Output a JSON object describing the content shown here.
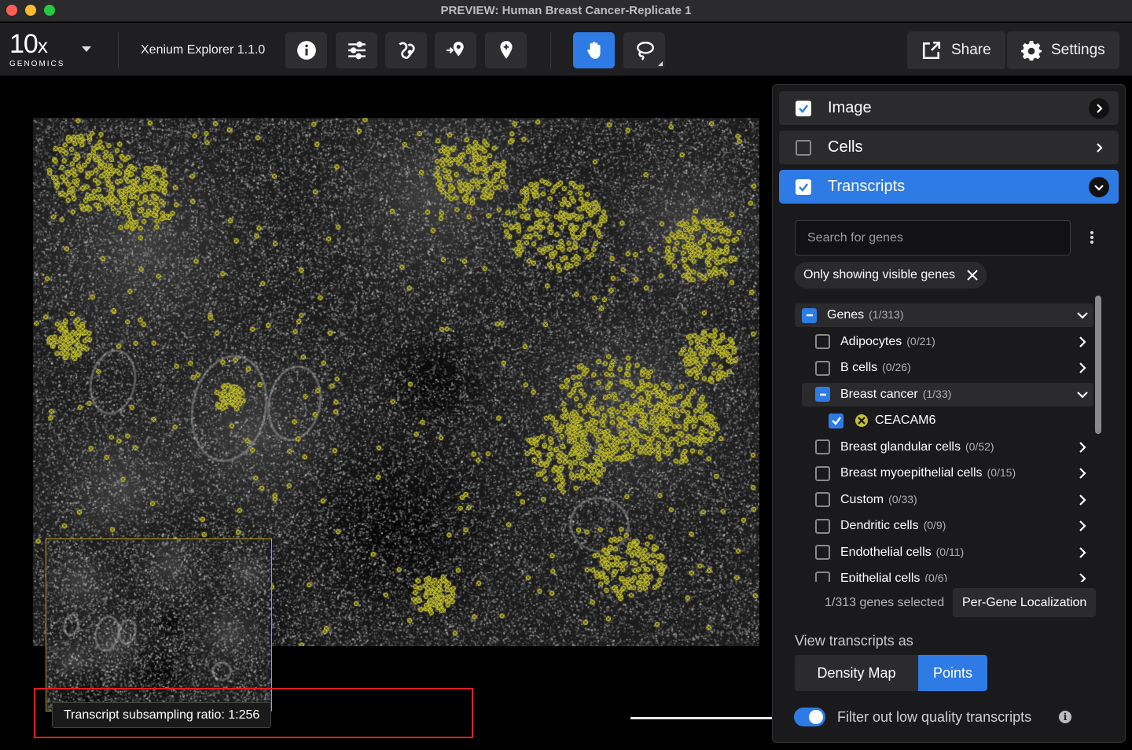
{
  "window": {
    "title": "PREVIEW: Human Breast Cancer-Replicate 1"
  },
  "toolbar": {
    "logo_main": "10",
    "logo_x": "x",
    "logo_sub": "GENOMICS",
    "app_name": "Xenium Explorer 1.1.0",
    "tools": [
      {
        "name": "info-icon",
        "active": false
      },
      {
        "name": "sliders-icon",
        "active": false
      },
      {
        "name": "cell-segment-icon",
        "active": false
      },
      {
        "name": "go-to-location-icon",
        "active": false
      },
      {
        "name": "pin-icon",
        "active": false
      },
      {
        "name": "hand-pan-icon",
        "active": true
      },
      {
        "name": "lasso-icon",
        "active": false
      }
    ],
    "share_label": "Share",
    "settings_label": "Settings"
  },
  "viewer": {
    "status_text": "Transcript subsampling ratio: 1:256",
    "transcript_color": "#c5c12b"
  },
  "panel": {
    "sections": [
      {
        "label": "Image",
        "checked": true,
        "expanded": false
      },
      {
        "label": "Cells",
        "checked": false,
        "expanded": false
      },
      {
        "label": "Transcripts",
        "checked": true,
        "expanded": true
      }
    ],
    "search_placeholder": "Search for genes",
    "filter_chip": "Only showing visible genes",
    "genes": [
      {
        "label": "Genes",
        "count": "(1/313)",
        "state": "partial",
        "level": 0,
        "expanded": true
      },
      {
        "label": "Adipocytes",
        "count": "(0/21)",
        "state": "off",
        "level": 1
      },
      {
        "label": "B cells",
        "count": "(0/26)",
        "state": "off",
        "level": 1
      },
      {
        "label": "Breast cancer",
        "count": "(1/33)",
        "state": "partial",
        "level": 1,
        "expanded": true
      },
      {
        "label": "CEACAM6",
        "count": "",
        "state": "on",
        "level": 2
      },
      {
        "label": "Breast glandular cells",
        "count": "(0/52)",
        "state": "off",
        "level": 1
      },
      {
        "label": "Breast myoepithelial cells",
        "count": "(0/15)",
        "state": "off",
        "level": 1
      },
      {
        "label": "Custom",
        "count": "(0/33)",
        "state": "off",
        "level": 1
      },
      {
        "label": "Dendritic cells",
        "count": "(0/9)",
        "state": "off",
        "level": 1
      },
      {
        "label": "Endothelial cells",
        "count": "(0/11)",
        "state": "off",
        "level": 1
      },
      {
        "label": "Epithelial cells",
        "count": "(0/6)",
        "state": "off",
        "level": 1
      }
    ],
    "selected_count": "1/313 genes selected",
    "per_gene_button": "Per-Gene Localization",
    "view_as_label": "View transcripts as",
    "view_options": [
      "Density Map",
      "Points"
    ],
    "view_selected": "Points",
    "filter_toggle_label": "Filter out low quality transcripts",
    "filter_toggle_on": true,
    "accent_color": "#2f7be5"
  }
}
